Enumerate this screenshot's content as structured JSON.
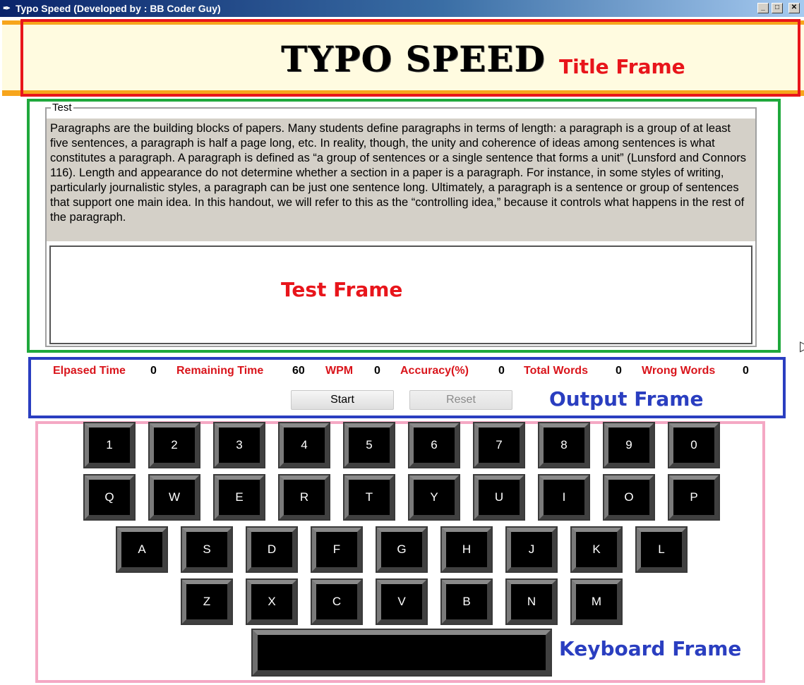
{
  "window": {
    "title": "Typo Speed (Developed by : BB Coder Guy)",
    "icon": "feather-icon",
    "minimize_label": "_",
    "maximize_label": "□",
    "close_label": "✕"
  },
  "title_frame": {
    "app_title": "TYPO SPEED",
    "annotation": "Title Frame"
  },
  "test_frame": {
    "legend": "Test",
    "paragraph": "Paragraphs are the building blocks of papers. Many students define paragraphs in terms of length: a paragraph is a group of at least five sentences, a paragraph is half a page long, etc. In reality, though, the unity and coherence of ideas among sentences is what constitutes a paragraph. A paragraph is defined as “a group of sentences or a single sentence that forms a unit” (Lunsford and Connors 116). Length and appearance do not determine whether a section in a paper is a paragraph. For instance, in some styles of writing, particularly journalistic styles, a paragraph can be just one sentence long. Ultimately, a paragraph is a sentence or group of sentences that support one main idea. In this handout, we will refer to this as the “controlling idea,” because it controls what happens in the rest of the paragraph.",
    "input_value": "",
    "annotation": "Test Frame"
  },
  "output_frame": {
    "stats": [
      {
        "label": "Elpased Time",
        "value": "0"
      },
      {
        "label": "Remaining Time",
        "value": "60"
      },
      {
        "label": "WPM",
        "value": "0"
      },
      {
        "label": "Accuracy(%)",
        "value": "0"
      },
      {
        "label": "Total Words",
        "value": "0"
      },
      {
        "label": "Wrong Words",
        "value": "0"
      }
    ],
    "start_label": "Start",
    "reset_label": "Reset",
    "annotation": "Output Frame"
  },
  "keyboard_frame": {
    "rows": [
      [
        "1",
        "2",
        "3",
        "4",
        "5",
        "6",
        "7",
        "8",
        "9",
        "0"
      ],
      [
        "Q",
        "W",
        "E",
        "R",
        "T",
        "Y",
        "U",
        "I",
        "O",
        "P"
      ],
      [
        "A",
        "S",
        "D",
        "F",
        "G",
        "H",
        "J",
        "K",
        "L"
      ],
      [
        "Z",
        "X",
        "C",
        "V",
        "B",
        "N",
        "M"
      ]
    ],
    "space_label": "",
    "annotation": "Keyboard Frame"
  },
  "colors": {
    "title_frame_border": "#e8151b",
    "test_frame_border": "#1fa83c",
    "output_frame_border": "#2a3ec0",
    "keyboard_frame_border": "#f4a8c4",
    "stat_label": "#d9141b",
    "annotation_red": "#e8151b",
    "annotation_blue": "#2a3ec0"
  }
}
